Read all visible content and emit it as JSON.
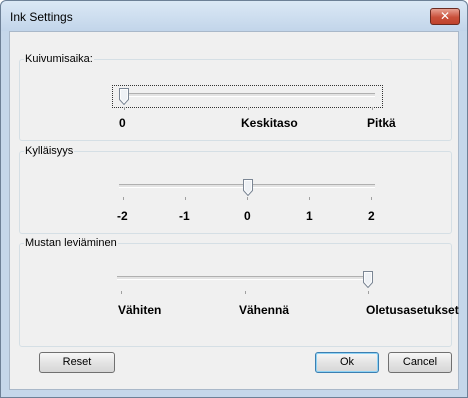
{
  "window": {
    "title": "Ink Settings",
    "close_symbol": "✕"
  },
  "groups": {
    "drying": {
      "label": "Kuivumisaika:",
      "value_position": 0,
      "labels": [
        "0",
        "Keskitaso",
        "Pitkä"
      ]
    },
    "saturation": {
      "label": "Kylläisyys",
      "value": "0",
      "labels": [
        "-2",
        "-1",
        "0",
        "1",
        "2"
      ]
    },
    "black_spread": {
      "label": "Mustan leviäminen",
      "value": "Oletusasetukset",
      "labels": [
        "Vähiten",
        "Vähennä",
        "Oletusasetukset"
      ]
    }
  },
  "buttons": {
    "reset": "Reset",
    "ok": "Ok",
    "cancel": "Cancel"
  },
  "icons": {
    "close": "close-icon",
    "slider_thumb": "slider-thumb-icon"
  }
}
